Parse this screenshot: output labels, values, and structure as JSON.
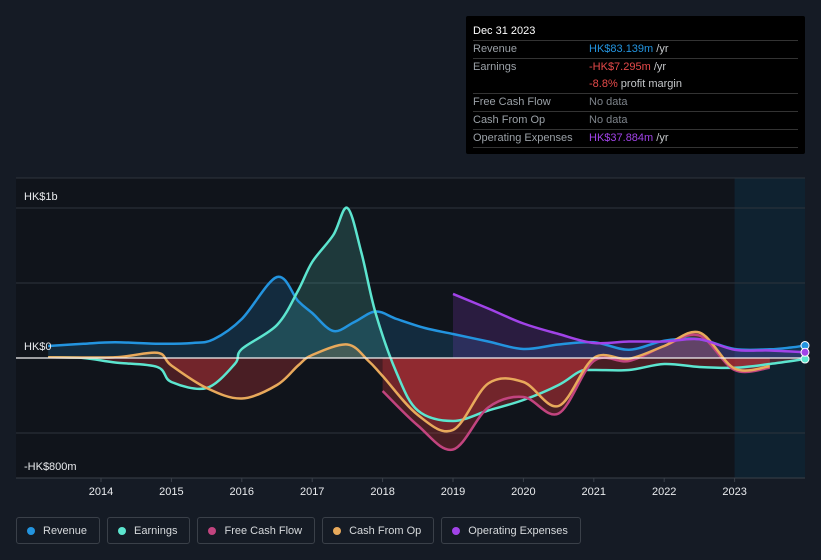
{
  "tooltip": {
    "date": "Dec 31 2023",
    "rows": [
      {
        "label": "Revenue",
        "value": "HK$83.139m",
        "unit": " /yr",
        "color": "#2394df"
      },
      {
        "label": "Earnings",
        "value": "-HK$7.295m",
        "unit": " /yr",
        "color": "#e64a4a"
      },
      {
        "label": "",
        "value": "-8.8%",
        "unit": " profit margin",
        "color": "#e64a4a"
      },
      {
        "label": "Free Cash Flow",
        "value": "No data",
        "unit": "",
        "color": "#7d838a"
      },
      {
        "label": "Cash From Op",
        "value": "No data",
        "unit": "",
        "color": "#7d838a"
      },
      {
        "label": "Operating Expenses",
        "value": "HK$37.884m",
        "unit": " /yr",
        "color": "#a143e8"
      }
    ]
  },
  "legend": [
    {
      "label": "Revenue",
      "color": "#2394df"
    },
    {
      "label": "Earnings",
      "color": "#5ce5cf"
    },
    {
      "label": "Free Cash Flow",
      "color": "#c2447f"
    },
    {
      "label": "Cash From Op",
      "color": "#e8a95b"
    },
    {
      "label": "Operating Expenses",
      "color": "#a143e8"
    }
  ],
  "chart_data": {
    "type": "area",
    "title": "",
    "xlabel": "",
    "ylabel": "",
    "currency_unit": "HK$ millions",
    "y_tick_labels": [
      {
        "value": 1000,
        "label": "HK$1b"
      },
      {
        "value": 0,
        "label": "HK$0"
      },
      {
        "value": -800,
        "label": "-HK$800m"
      }
    ],
    "gridlines": [
      1000,
      500,
      0,
      -500
    ],
    "ylim": [
      -800,
      1200
    ],
    "xlim": [
      2013.2,
      2024.0
    ],
    "x_ticks": [
      2014,
      2015,
      2016,
      2017,
      2018,
      2019,
      2020,
      2021,
      2022,
      2023
    ],
    "highlight_from": 2023.0,
    "legend_position": "bottom-left",
    "series": [
      {
        "name": "Revenue",
        "color": "#2394df",
        "points": [
          [
            2013.25,
            80
          ],
          [
            2013.75,
            95
          ],
          [
            2014.2,
            105
          ],
          [
            2014.8,
            95
          ],
          [
            2015.3,
            100
          ],
          [
            2015.6,
            125
          ],
          [
            2016.0,
            260
          ],
          [
            2016.5,
            540
          ],
          [
            2016.8,
            380
          ],
          [
            2017.0,
            300
          ],
          [
            2017.3,
            180
          ],
          [
            2017.6,
            240
          ],
          [
            2017.9,
            310
          ],
          [
            2018.2,
            260
          ],
          [
            2018.6,
            200
          ],
          [
            2019.0,
            160
          ],
          [
            2019.5,
            110
          ],
          [
            2020.0,
            60
          ],
          [
            2020.5,
            90
          ],
          [
            2021.0,
            105
          ],
          [
            2021.5,
            55
          ],
          [
            2022.0,
            115
          ],
          [
            2022.5,
            125
          ],
          [
            2023.0,
            60
          ],
          [
            2023.5,
            58
          ],
          [
            2023.8,
            70
          ],
          [
            2024.0,
            83
          ]
        ]
      },
      {
        "name": "Earnings",
        "color": "#5ce5cf",
        "points": [
          [
            2013.25,
            5
          ],
          [
            2013.75,
            0
          ],
          [
            2014.2,
            -30
          ],
          [
            2014.8,
            -60
          ],
          [
            2015.0,
            -160
          ],
          [
            2015.5,
            -200
          ],
          [
            2015.9,
            -40
          ],
          [
            2016.0,
            60
          ],
          [
            2016.5,
            220
          ],
          [
            2016.8,
            450
          ],
          [
            2017.0,
            640
          ],
          [
            2017.3,
            820
          ],
          [
            2017.5,
            1000
          ],
          [
            2017.7,
            700
          ],
          [
            2017.9,
            300
          ],
          [
            2018.2,
            -100
          ],
          [
            2018.5,
            -350
          ],
          [
            2019.0,
            -420
          ],
          [
            2019.5,
            -350
          ],
          [
            2020.0,
            -280
          ],
          [
            2020.5,
            -180
          ],
          [
            2020.8,
            -90
          ],
          [
            2021.0,
            -80
          ],
          [
            2021.5,
            -80
          ],
          [
            2022.0,
            -40
          ],
          [
            2022.5,
            -60
          ],
          [
            2023.0,
            -65
          ],
          [
            2023.5,
            -40
          ],
          [
            2024.0,
            -7
          ]
        ]
      },
      {
        "name": "Free Cash Flow",
        "color": "#c2447f",
        "points": [
          [
            2018.0,
            -220
          ],
          [
            2018.5,
            -450
          ],
          [
            2019.0,
            -610
          ],
          [
            2019.5,
            -330
          ],
          [
            2020.0,
            -260
          ],
          [
            2020.5,
            -370
          ],
          [
            2021.0,
            -20
          ],
          [
            2021.5,
            -20
          ],
          [
            2022.0,
            80
          ],
          [
            2022.5,
            150
          ],
          [
            2023.0,
            -80
          ],
          [
            2023.5,
            -65
          ]
        ]
      },
      {
        "name": "Cash From Op",
        "color": "#e8a95b",
        "points": [
          [
            2013.25,
            5
          ],
          [
            2014.2,
            5
          ],
          [
            2014.8,
            35
          ],
          [
            2015.0,
            -50
          ],
          [
            2015.5,
            -200
          ],
          [
            2016.0,
            -270
          ],
          [
            2016.5,
            -180
          ],
          [
            2016.8,
            -50
          ],
          [
            2017.0,
            20
          ],
          [
            2017.5,
            90
          ],
          [
            2017.8,
            -20
          ],
          [
            2018.0,
            -120
          ],
          [
            2018.5,
            -380
          ],
          [
            2019.0,
            -480
          ],
          [
            2019.5,
            -170
          ],
          [
            2020.0,
            -160
          ],
          [
            2020.5,
            -320
          ],
          [
            2021.0,
            0
          ],
          [
            2021.5,
            -5
          ],
          [
            2022.0,
            80
          ],
          [
            2022.5,
            170
          ],
          [
            2023.0,
            -70
          ],
          [
            2023.5,
            -55
          ]
        ]
      },
      {
        "name": "Operating Expenses",
        "color": "#a143e8",
        "points": [
          [
            2019.0,
            427
          ],
          [
            2019.5,
            330
          ],
          [
            2020.0,
            230
          ],
          [
            2020.5,
            160
          ],
          [
            2021.0,
            100
          ],
          [
            2021.5,
            110
          ],
          [
            2022.0,
            110
          ],
          [
            2022.5,
            125
          ],
          [
            2023.0,
            55
          ],
          [
            2023.5,
            50
          ],
          [
            2024.0,
            38
          ]
        ]
      }
    ]
  }
}
